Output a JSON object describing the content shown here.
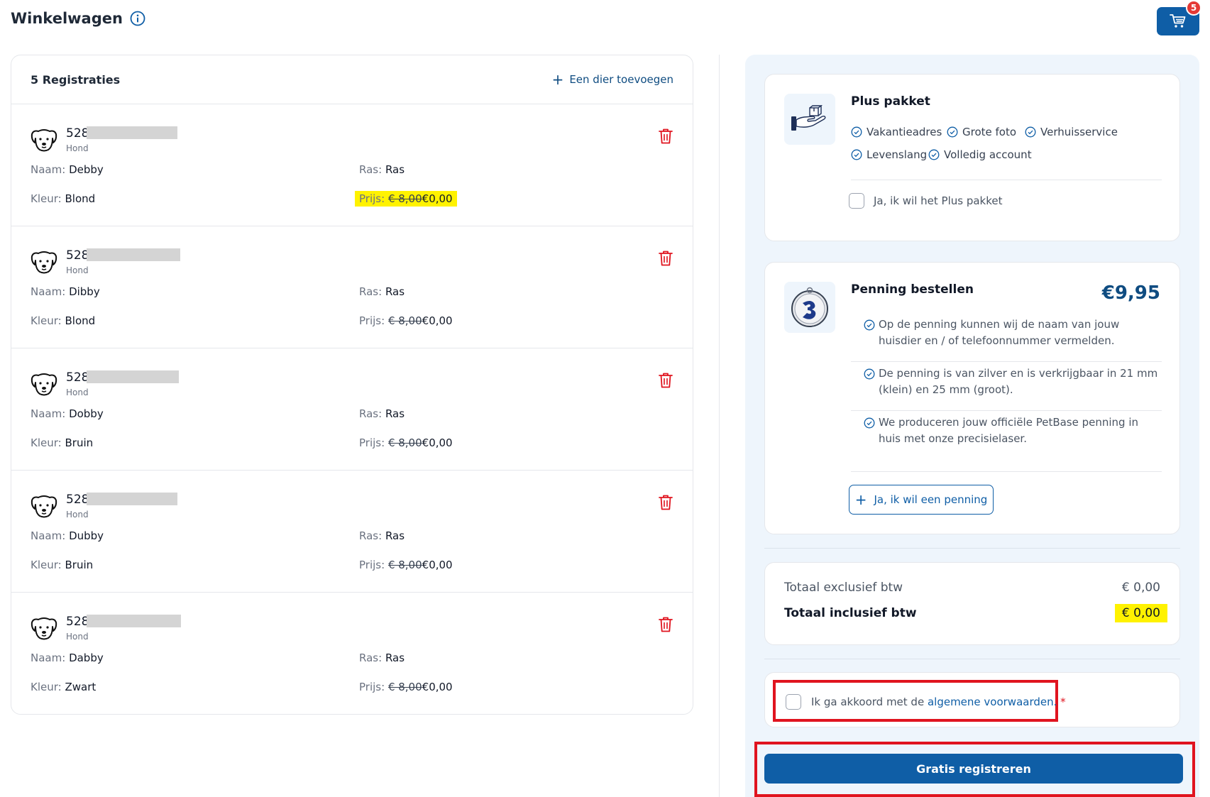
{
  "header": {
    "title": "Winkelwagen",
    "cart_count": "5"
  },
  "registrations": {
    "count_label": "5 Registraties",
    "add_label": "Een dier toevoegen",
    "items": [
      {
        "number": "528",
        "type": "Hond",
        "naam_label": "Naam:",
        "naam": "Debby",
        "ras_label": "Ras:",
        "ras": "Ras",
        "kleur_label": "Kleur:",
        "kleur": "Blond",
        "prijs_label": "Prijs:",
        "old_price": "€ 8,00",
        "price": "€0,00"
      },
      {
        "number": "528",
        "type": "Hond",
        "naam_label": "Naam:",
        "naam": "Dibby",
        "ras_label": "Ras:",
        "ras": "Ras",
        "kleur_label": "Kleur:",
        "kleur": "Blond",
        "prijs_label": "Prijs:",
        "old_price": "€ 8,00",
        "price": "€0,00"
      },
      {
        "number": "528",
        "type": "Hond",
        "naam_label": "Naam:",
        "naam": "Dobby",
        "ras_label": "Ras:",
        "ras": "Ras",
        "kleur_label": "Kleur:",
        "kleur": "Bruin",
        "prijs_label": "Prijs:",
        "old_price": "€ 8,00",
        "price": "€0,00"
      },
      {
        "number": "528",
        "type": "Hond",
        "naam_label": "Naam:",
        "naam": "Dubby",
        "ras_label": "Ras:",
        "ras": "Ras",
        "kleur_label": "Kleur:",
        "kleur": "Bruin",
        "prijs_label": "Prijs:",
        "old_price": "€ 8,00",
        "price": "€0,00"
      },
      {
        "number": "528",
        "type": "Hond",
        "naam_label": "Naam:",
        "naam": "Dabby",
        "ras_label": "Ras:",
        "ras": "Ras",
        "kleur_label": "Kleur:",
        "kleur": "Zwart",
        "prijs_label": "Prijs:",
        "old_price": "€ 8,00",
        "price": "€0,00"
      }
    ]
  },
  "plus_package": {
    "title": "Plus pakket",
    "features": [
      "Vakantieadres",
      "Grote foto",
      "Verhuisservice",
      "Levenslang",
      "Volledig account"
    ],
    "checkbox_label": "Ja, ik wil het Plus pakket"
  },
  "penning": {
    "title": "Penning bestellen",
    "price": "€9,95",
    "features": [
      "Op de penning kunnen wij de naam van jouw huisdier en / of telefoonnummer vermelden.",
      "De penning is van zilver en is verkrijgbaar in 21 mm (klein) en 25 mm (groot).",
      "We produceren jouw officiële PetBase penning in huis met onze precisielaser."
    ],
    "button_label": "Ja, ik wil een penning"
  },
  "totals": {
    "excl_label": "Totaal exclusief btw",
    "excl_value": "€ 0,00",
    "incl_label": "Totaal inclusief btw",
    "incl_value": "€ 0,00"
  },
  "terms": {
    "text": "Ik ga akkoord met de ",
    "link": "algemene voorwaarden.",
    "required": "*"
  },
  "register_button": "Gratis registreren",
  "colors": {
    "primary": "#0f5ea6",
    "highlight": "#fff200",
    "danger": "#e0141f",
    "panel_bg": "#eef5fc"
  }
}
